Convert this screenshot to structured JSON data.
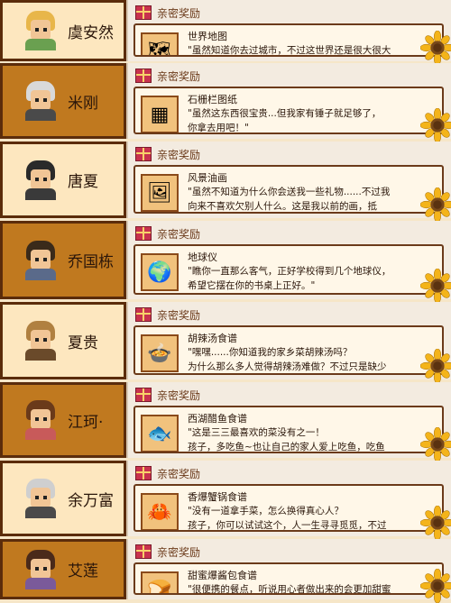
{
  "header_label": "亲密奖励",
  "rows": [
    {
      "name": "虞安然",
      "theme": "light",
      "item": "世界地图",
      "icon": "map-icon",
      "glyph": "🗺",
      "text": "\"虽然知道你去过城市，不过这世界还是很大很大\n，这是送给你地图，每个人都应该有走得越远、",
      "hair": "#e8b64a",
      "body": "#6aa050"
    },
    {
      "name": "米刚",
      "theme": "dark",
      "item": "石栅栏图纸",
      "icon": "blueprint-icon",
      "glyph": "▦",
      "text": "\"虽然这东西很宝贵...但我家有锤子就足够了，\n你拿去用吧！\"",
      "hair": "#d9d9d9",
      "body": "#4a4a4a"
    },
    {
      "name": "唐夏",
      "theme": "light",
      "item": "风景油画",
      "icon": "painting-icon",
      "glyph": "🖼",
      "text": "\"虽然不知道为什么你会送我一些礼物......不过我\n向来不喜欢欠别人什么。这是我以前的画，抵",
      "hair": "#2a2a2a",
      "body": "#3a3a3a"
    },
    {
      "name": "乔国栋",
      "theme": "dark",
      "item": "地球仪",
      "icon": "globe-icon",
      "glyph": "🌍",
      "text": "\"瞧你一直那么客气，正好学校得到几个地球仪，\n希望它摆在你的书桌上正好。\"",
      "hair": "#3a2a1a",
      "body": "#5a6a8a"
    },
    {
      "name": "夏贵",
      "theme": "light",
      "item": "胡辣汤食谱",
      "icon": "soup-icon",
      "glyph": "🍲",
      "text": "\"嘿嘿......你知道我的家乡菜胡辣汤吗？\n为什么那么多人觉得胡辣汤难做？不过只是缺少",
      "hair": "#b08040",
      "body": "#6a4a2a"
    },
    {
      "name": "江珂·",
      "theme": "dark",
      "item": "西湖醋鱼食谱",
      "icon": "fish-icon",
      "glyph": "🐟",
      "text": "\"这是三三最喜欢的菜没有之一！\n孩子，多吃鱼~也让自己的家人爱上吃鱼，吃鱼",
      "hair": "#6a3a1a",
      "body": "#c85a5a"
    },
    {
      "name": "余万富",
      "theme": "light",
      "item": "香爆蟹锅食谱",
      "icon": "crab-icon",
      "glyph": "🦀",
      "text": "\"没有一道拿手菜，怎么换得真心人？\n孩子，你可以试试这个，人一生寻寻觅觅，不过",
      "hair": "#cfcfcf",
      "body": "#4a4a4a"
    },
    {
      "name": "艾莲",
      "theme": "dark",
      "item": "甜蜜爆酱包食谱",
      "icon": "bun-icon",
      "glyph": "🍞",
      "text": "\"很便携的餐点，听说用心者做出来的会更加甜蜜",
      "hair": "#4a2a1a",
      "body": "#7a5a9a"
    }
  ]
}
